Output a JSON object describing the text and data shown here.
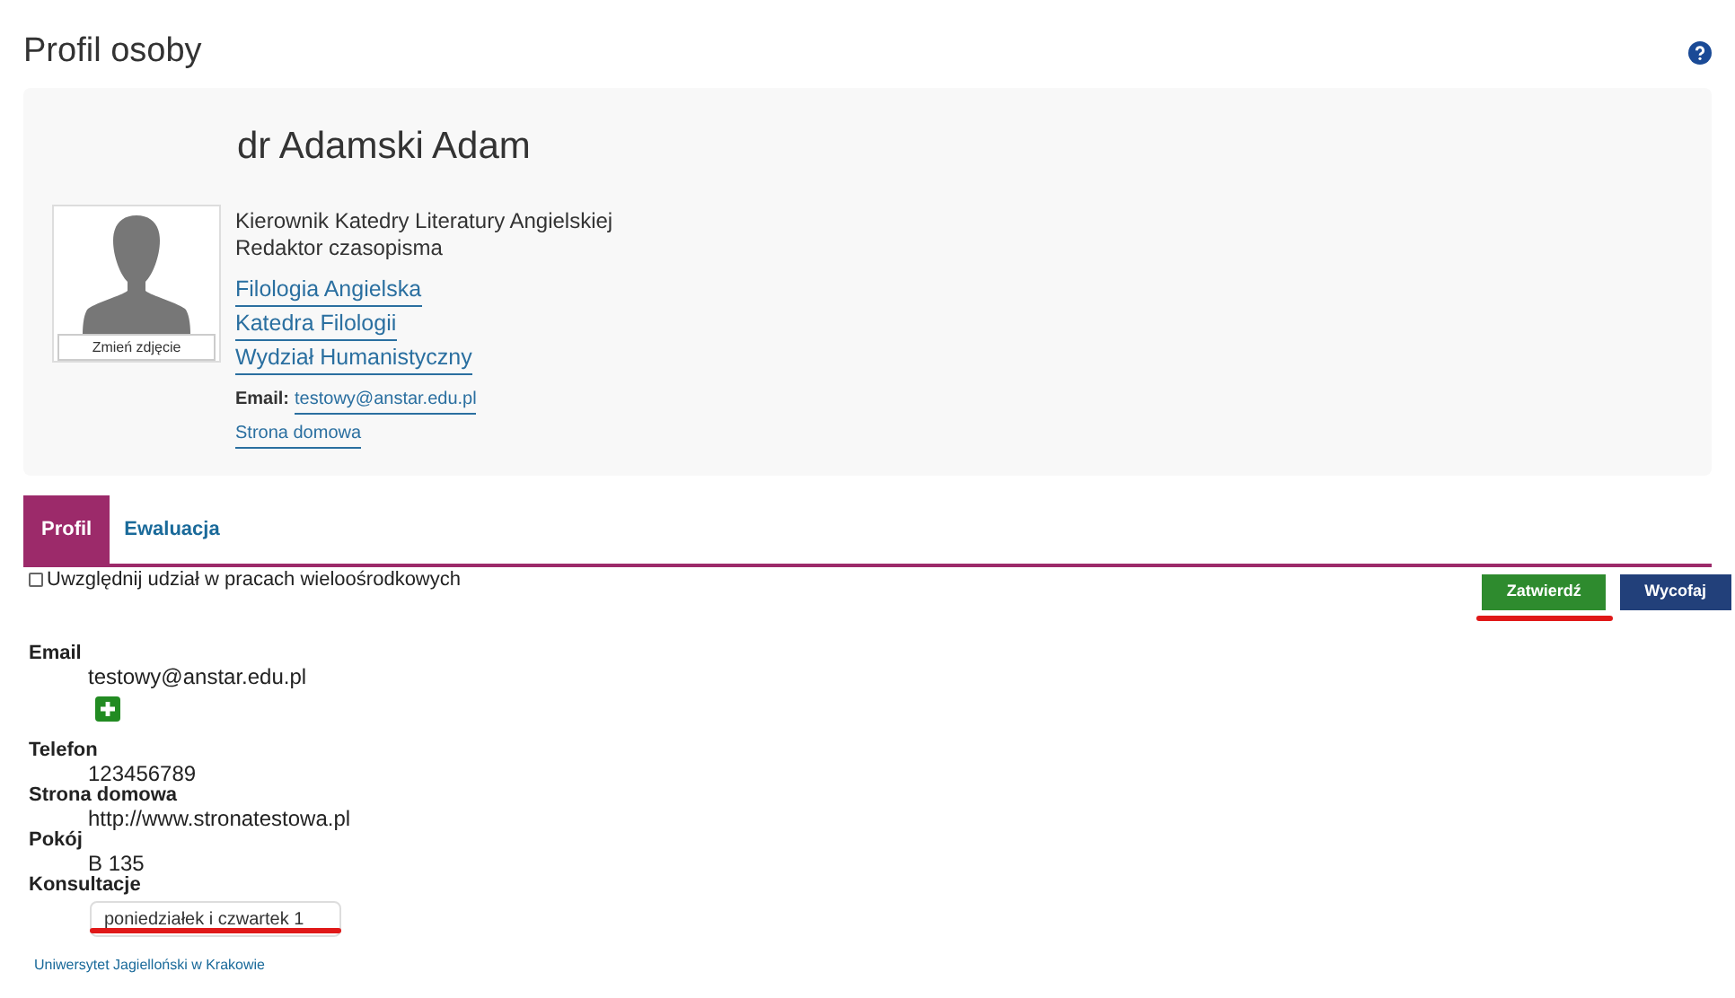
{
  "page_title": "Profil osoby",
  "profile": {
    "name": "dr Adamski Adam",
    "photo_button": "Zmień zdjęcie",
    "roles": [
      "Kierownik Katedry Literatury Angielskiej",
      "Redaktor czasopisma"
    ],
    "units": [
      "Filologia Angielska",
      "Katedra Filologii",
      "Wydział Humanistyczny"
    ],
    "email_label": "Email:",
    "email": "testowy@anstar.edu.pl",
    "homepage_link": "Strona domowa"
  },
  "tabs": [
    {
      "label": "Profil",
      "selected": true
    },
    {
      "label": "Ewaluacja",
      "selected": false
    }
  ],
  "multicenter": {
    "label": "Uwzględnij udział w pracach wieloośrodkowych",
    "checked": false
  },
  "buttons": [
    {
      "label": "Zatwierdź",
      "kind": "confirm"
    },
    {
      "label": "Wycofaj",
      "kind": "cancel"
    }
  ],
  "fields": [
    {
      "label": "Email",
      "value": "testowy@anstar.edu.pl",
      "kind": "email"
    },
    {
      "label": "Telefon",
      "value": "123456789",
      "kind": "text"
    },
    {
      "label": "Strona domowa",
      "value": "http://www.stronatestowa.pl",
      "kind": "text"
    },
    {
      "label": "Pokój",
      "value": "B 135",
      "kind": "text"
    },
    {
      "label": "Konsultacje",
      "value": "poniedziałek i czwartek 1",
      "kind": "input"
    }
  ],
  "footer": "Uniwersytet Jagielloński w Krakowie"
}
